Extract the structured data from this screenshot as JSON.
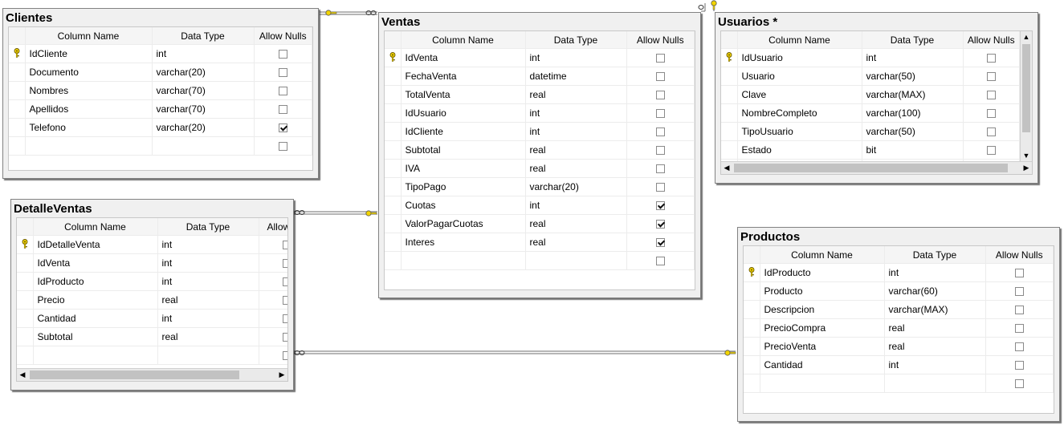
{
  "grid_headers": {
    "column_name": "Column Name",
    "data_type": "Data Type",
    "allow_nulls": "Allow Nulls"
  },
  "colors": {
    "key_icon": "#f2d400",
    "relation_line": "#6e6e6e"
  },
  "tables": {
    "clientes": {
      "title": "Clientes",
      "allow_nulls_header": "Allow Nulls",
      "columns": [
        {
          "name": "IdCliente",
          "type": "int",
          "pk": true,
          "nulls": false
        },
        {
          "name": "Documento",
          "type": "varchar(20)",
          "pk": false,
          "nulls": false
        },
        {
          "name": "Nombres",
          "type": "varchar(70)",
          "pk": false,
          "nulls": false
        },
        {
          "name": "Apellidos",
          "type": "varchar(70)",
          "pk": false,
          "nulls": false
        },
        {
          "name": "Telefono",
          "type": "varchar(20)",
          "pk": false,
          "nulls": true
        }
      ]
    },
    "ventas": {
      "title": "Ventas",
      "allow_nulls_header": "Allow Nulls",
      "columns": [
        {
          "name": "IdVenta",
          "type": "int",
          "pk": true,
          "nulls": false
        },
        {
          "name": "FechaVenta",
          "type": "datetime",
          "pk": false,
          "nulls": false
        },
        {
          "name": "TotalVenta",
          "type": "real",
          "pk": false,
          "nulls": false
        },
        {
          "name": "IdUsuario",
          "type": "int",
          "pk": false,
          "nulls": false
        },
        {
          "name": "IdCliente",
          "type": "int",
          "pk": false,
          "nulls": false
        },
        {
          "name": "Subtotal",
          "type": "real",
          "pk": false,
          "nulls": false
        },
        {
          "name": "IVA",
          "type": "real",
          "pk": false,
          "nulls": false
        },
        {
          "name": "TipoPago",
          "type": "varchar(20)",
          "pk": false,
          "nulls": false
        },
        {
          "name": "Cuotas",
          "type": "int",
          "pk": false,
          "nulls": true
        },
        {
          "name": "ValorPagarCuotas",
          "type": "real",
          "pk": false,
          "nulls": true
        },
        {
          "name": "Interes",
          "type": "real",
          "pk": false,
          "nulls": true
        }
      ]
    },
    "usuarios": {
      "title": "Usuarios *",
      "allow_nulls_header": "Allow Nulls",
      "columns": [
        {
          "name": "IdUsuario",
          "type": "int",
          "pk": true,
          "nulls": false
        },
        {
          "name": "Usuario",
          "type": "varchar(50)",
          "pk": false,
          "nulls": false
        },
        {
          "name": "Clave",
          "type": "varchar(MAX)",
          "pk": false,
          "nulls": false
        },
        {
          "name": "NombreCompleto",
          "type": "varchar(100)",
          "pk": false,
          "nulls": false
        },
        {
          "name": "TipoUsuario",
          "type": "varchar(50)",
          "pk": false,
          "nulls": false
        },
        {
          "name": "Estado",
          "type": "bit",
          "pk": false,
          "nulls": false
        }
      ]
    },
    "detalleventas": {
      "title": "DetalleVentas",
      "allow_nulls_header": "Allow",
      "columns": [
        {
          "name": "IdDetalleVenta",
          "type": "int",
          "pk": true,
          "nulls": false
        },
        {
          "name": "IdVenta",
          "type": "int",
          "pk": false,
          "nulls": false
        },
        {
          "name": "IdProducto",
          "type": "int",
          "pk": false,
          "nulls": false
        },
        {
          "name": "Precio",
          "type": "real",
          "pk": false,
          "nulls": false
        },
        {
          "name": "Cantidad",
          "type": "int",
          "pk": false,
          "nulls": false
        },
        {
          "name": "Subtotal",
          "type": "real",
          "pk": false,
          "nulls": false
        }
      ]
    },
    "productos": {
      "title": "Productos",
      "allow_nulls_header": "Allow Nulls",
      "columns": [
        {
          "name": "IdProducto",
          "type": "int",
          "pk": true,
          "nulls": false
        },
        {
          "name": "Producto",
          "type": "varchar(60)",
          "pk": false,
          "nulls": false
        },
        {
          "name": "Descripcion",
          "type": "varchar(MAX)",
          "pk": false,
          "nulls": false
        },
        {
          "name": "PrecioCompra",
          "type": "real",
          "pk": false,
          "nulls": false
        },
        {
          "name": "PrecioVenta",
          "type": "real",
          "pk": false,
          "nulls": false
        },
        {
          "name": "Cantidad",
          "type": "int",
          "pk": false,
          "nulls": false
        }
      ]
    }
  },
  "relationships": [
    {
      "name": "clientes-ventas",
      "one": "clientes",
      "many": "ventas"
    },
    {
      "name": "usuarios-ventas",
      "one": "usuarios",
      "many": "ventas"
    },
    {
      "name": "ventas-detalleventas",
      "one": "ventas",
      "many": "detalleventas"
    },
    {
      "name": "productos-detalleventas",
      "one": "productos",
      "many": "detalleventas"
    }
  ]
}
